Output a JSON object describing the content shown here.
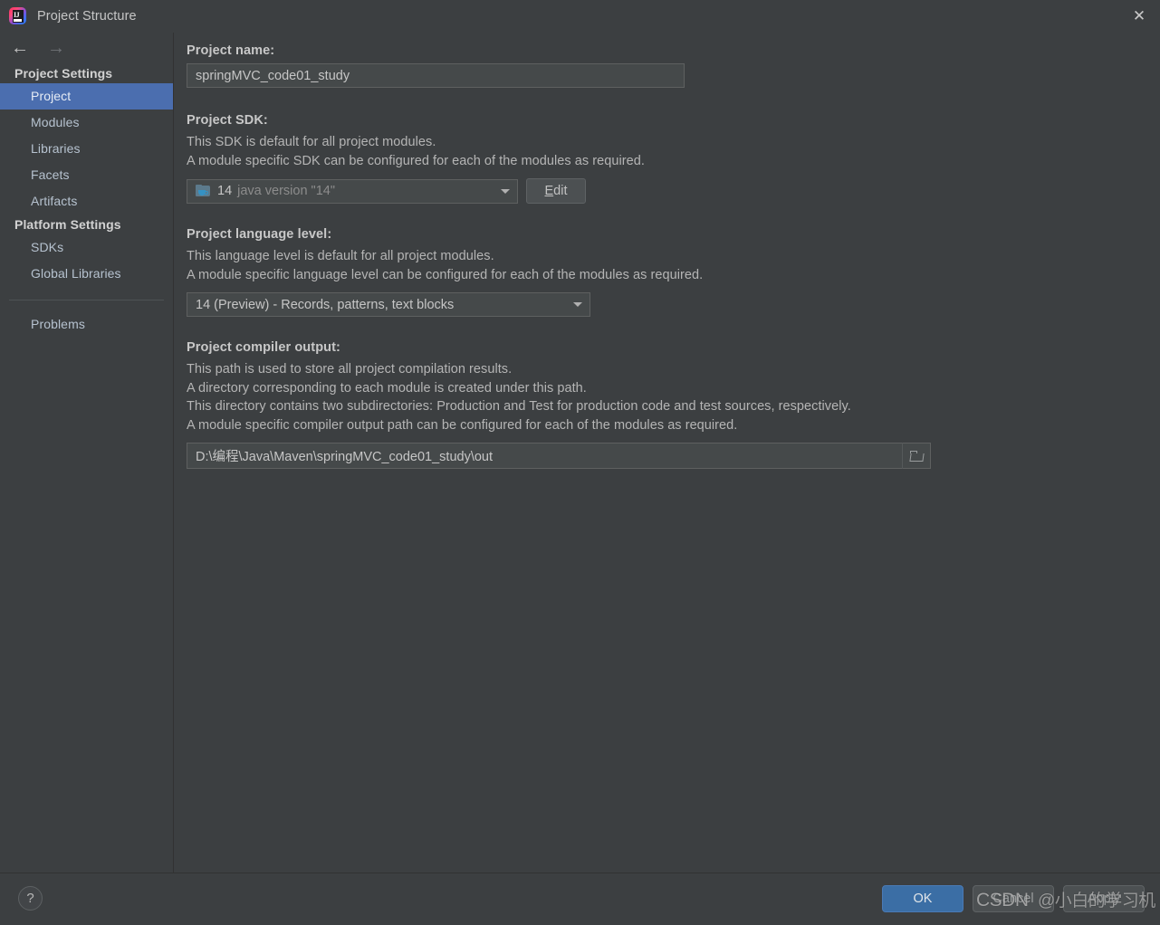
{
  "window": {
    "title": "Project Structure",
    "app_icon": "intellij-idea-logo",
    "close_label": "✕"
  },
  "nav": {
    "back": "←",
    "forward": "→"
  },
  "sidebar": {
    "groups": [
      {
        "label": "Project Settings",
        "items": [
          {
            "label": "Project",
            "selected": true
          },
          {
            "label": "Modules",
            "selected": false
          },
          {
            "label": "Libraries",
            "selected": false
          },
          {
            "label": "Facets",
            "selected": false
          },
          {
            "label": "Artifacts",
            "selected": false
          }
        ]
      },
      {
        "label": "Platform Settings",
        "items": [
          {
            "label": "SDKs",
            "selected": false
          },
          {
            "label": "Global Libraries",
            "selected": false
          }
        ]
      }
    ],
    "problems_label": "Problems"
  },
  "main": {
    "project_name": {
      "label": "Project name:",
      "value": "springMVC_code01_study",
      "placeholder": ""
    },
    "project_sdk": {
      "label": "Project SDK:",
      "desc_line1": "This SDK is default for all project modules.",
      "desc_line2": "A module specific SDK can be configured for each of the modules as required.",
      "selected_version": "14",
      "selected_desc": "java version \"14\"",
      "icon": "java-sdk-folder-icon",
      "edit_button": "Edit",
      "edit_mnemonic": "E",
      "edit_rest": "dit"
    },
    "language_level": {
      "label": "Project language level:",
      "desc_line1": "This language level is default for all project modules.",
      "desc_line2": "A module specific language level can be configured for each of the modules as required.",
      "selected": "14 (Preview) - Records, patterns, text blocks"
    },
    "compiler_output": {
      "label": "Project compiler output:",
      "desc_line1": "This path is used to store all project compilation results.",
      "desc_line2": "A directory corresponding to each module is created under this path.",
      "desc_line3": "This directory contains two subdirectories: Production and Test for production code and test sources, respectively.",
      "desc_line4": "A module specific compiler output path can be configured for each of the modules as required.",
      "value": "D:\\编程\\Java\\Maven\\springMVC_code01_study\\out",
      "browse_icon": "folder-browse-icon"
    }
  },
  "footer": {
    "help": "?",
    "buttons": [
      {
        "label": "OK",
        "style": "primary"
      },
      {
        "label": "Cancel",
        "style": "normal"
      },
      {
        "label": "Apply",
        "style": "normal"
      }
    ]
  },
  "watermark": {
    "text": "CSDN",
    "text2": "@小白的学习机"
  },
  "colors": {
    "background": "#3c3f41",
    "selection": "#4b6eaf",
    "field": "#45494a",
    "primary_button": "#3b6ea5",
    "text": "#bbbbbb"
  }
}
